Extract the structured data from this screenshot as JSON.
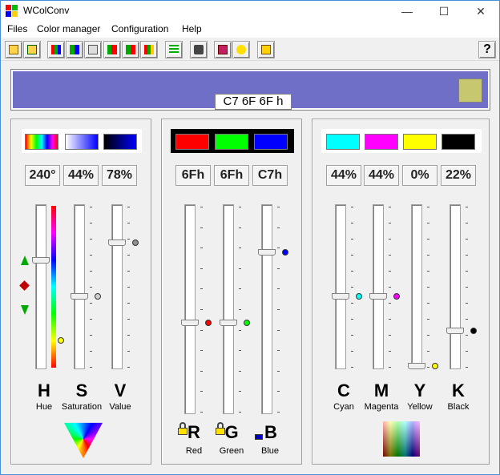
{
  "window": {
    "title": "WColConv",
    "minimize": "—",
    "maximize": "☐",
    "close": "✕"
  },
  "menu": [
    "Files",
    "Color manager",
    "Configuration",
    "Help"
  ],
  "toolbar": {
    "help_label": "?"
  },
  "preview": {
    "hex": "C7 6F 6F h",
    "color": "#6f6fc7",
    "complement": "#c7c76f"
  },
  "hsv": {
    "readouts": [
      "240°",
      "44%",
      "78%"
    ],
    "letters": [
      "H",
      "S",
      "V"
    ],
    "labels": [
      "Hue",
      "Saturation",
      "Value"
    ],
    "levels": {
      "hue": 0.667,
      "saturation": 0.44,
      "value": 0.78
    }
  },
  "rgb": {
    "readouts": [
      "6Fh",
      "6Fh",
      "C7h"
    ],
    "letters": [
      "R",
      "G",
      "B"
    ],
    "labels": [
      "Red",
      "Green",
      "Blue"
    ],
    "levels": {
      "red": 0.435,
      "green": 0.435,
      "blue": 0.78
    }
  },
  "cmyk": {
    "readouts": [
      "44%",
      "44%",
      "0%",
      "22%"
    ],
    "letters": [
      "C",
      "M",
      "Y",
      "K"
    ],
    "labels": [
      "Cyan",
      "Magenta",
      "Yellow",
      "Black"
    ],
    "levels": {
      "cyan": 0.44,
      "magenta": 0.44,
      "yellow": 0.0,
      "black": 0.22
    }
  },
  "colors": {
    "red": "#ff0000",
    "green": "#00ff00",
    "blue": "#0000ff",
    "cyan": "#00ffff",
    "magenta": "#ff00ff",
    "yellow": "#ffff00",
    "black": "#000000"
  }
}
